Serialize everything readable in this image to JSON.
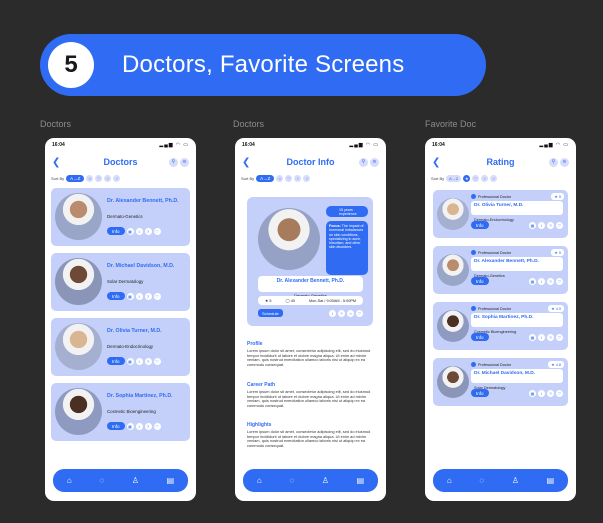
{
  "banner": {
    "number": "5",
    "title": "Doctors, Favorite Screens"
  },
  "captions": [
    "Doctors",
    "Doctors",
    "Favorite Doc"
  ],
  "status": {
    "time": "16:04",
    "icons": "▂▄▆ ◠ ▭"
  },
  "screen1": {
    "title": "Doctors",
    "sort_label": "Sort By",
    "sort_pill": "A→Z",
    "doctors": [
      {
        "name": "Dr. Alexander Bennett, Ph.D.",
        "spec": "Dermato-Genetics"
      },
      {
        "name": "Dr. Michael Davidson, M.D.",
        "spec": "Solar Dermatology"
      },
      {
        "name": "Dr. Olivia Turner, M.D.",
        "spec": "Dermato-Endocrinology"
      },
      {
        "name": "Dr. Sophia Martinez, Ph.D.",
        "spec": "Cosmetic Bioengineering"
      }
    ],
    "info": "Info"
  },
  "screen2": {
    "title": "Doctor Info",
    "sort_label": "Sort By",
    "sort_pill": "A→Z",
    "experience": "15 years experience",
    "focus_label": "Focus:",
    "focus_text": "The impact of hormonal imbalances on skin conditions, specializing in acne, hirsutism, and other skin disorders.",
    "name": "Dr. Alexander Bennett, Ph.D.",
    "spec": "Dermato-Genetics",
    "rating": "★ 5",
    "reviews": "◯ 40",
    "hours": "Mon-Sat / 9:00AM - 5:00PM",
    "schedule": "Schedule",
    "sections": [
      {
        "heading": "Profile",
        "text": "Lorem ipsum dolor sit amet, consectetur adipiscing elit, sed do eiusmod tempor incididunt ut labore et dolore magna aliqua. Ut enim ad minim veniam, quis nostrud exercitation ullamco laboris nisi ut aliquip ex ea commodo consequat."
      },
      {
        "heading": "Career Path",
        "text": "Lorem ipsum dolor sit amet, consectetur adipiscing elit, sed do eiusmod tempor incididunt ut labore et dolore magna aliqua. Ut enim ad minim veniam, quis nostrud exercitation ullamco laboris nisi ut aliquip ex ea commodo consequat."
      },
      {
        "heading": "Highlights",
        "text": "Lorem ipsum dolor sit amet, consectetur adipiscing elit, sed do eiusmod tempor incididunt ut labore et dolore magna aliqua. Ut enim ad minim veniam, quis nostrud exercitation ullamco laboris nisi ut aliquip ex ea commodo consequat."
      }
    ]
  },
  "screen3": {
    "title": "Rating",
    "sort_label": "Sort By",
    "sort_pill": "A→Z",
    "tag": "Professional Doctor",
    "info": "Info",
    "doctors": [
      {
        "name": "Dr. Olivia Turner, M.D.",
        "spec": "Dermato-Endocrinology",
        "rating": "★ 5"
      },
      {
        "name": "Dr. Alexander Bennett, Ph.D.",
        "spec": "Dermato-Genetics",
        "rating": "★ 5"
      },
      {
        "name": "Dr. Sophia Martinez, Ph.D.",
        "spec": "Cosmetic Bioengineering",
        "rating": "★ 4.9"
      },
      {
        "name": "Dr. Michael Davidson, M.D.",
        "spec": "Solar Dermatology",
        "rating": "★ 4.8"
      }
    ]
  },
  "colors": {
    "accent": "#2f6cf3",
    "card": "#c5d0fa",
    "background": "#2b2b2b"
  },
  "icons": {
    "nav": [
      "home-icon",
      "chat-icon",
      "user-icon",
      "calendar-icon"
    ]
  }
}
